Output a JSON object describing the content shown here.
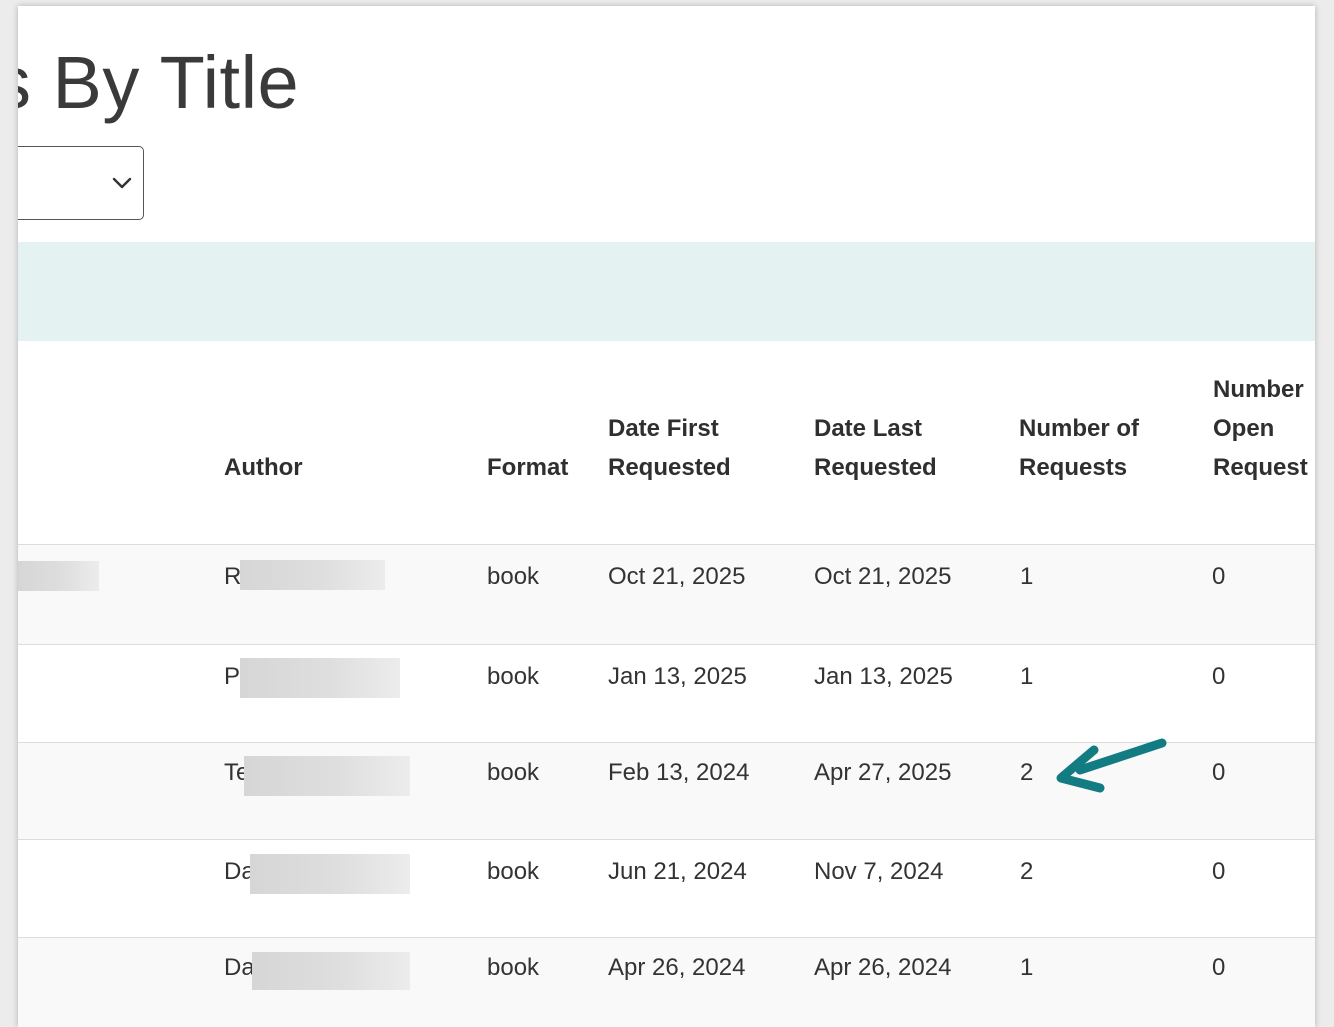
{
  "page": {
    "title": "s By Title"
  },
  "filter": {
    "selected": ""
  },
  "table": {
    "headers": {
      "author": "Author",
      "format": "Format",
      "first_line1": "Date First",
      "first_line2": "Requested",
      "last_line1": "Date Last",
      "last_line2": "Requested",
      "num_line1": "Number of",
      "num_line2": "Requests",
      "open_line1": "Number",
      "open_line2": "Open",
      "open_line3": "Request"
    },
    "rows": [
      {
        "author": "R",
        "format": "book",
        "first": "Oct 21, 2025",
        "last": "Oct 21, 2025",
        "requests": "1",
        "open": "0"
      },
      {
        "author": "P",
        "format": "book",
        "first": "Jan 13, 2025",
        "last": "Jan 13, 2025",
        "requests": "1",
        "open": "0"
      },
      {
        "author": "Te",
        "format": "book",
        "first": "Feb 13, 2024",
        "last": "Apr 27, 2025",
        "requests": "2",
        "open": "0"
      },
      {
        "author": "Da",
        "format": "book",
        "first": "Jun 21, 2024",
        "last": "Nov 7, 2024",
        "requests": "2",
        "open": "0"
      },
      {
        "author": "Da",
        "format": "book",
        "first": "Apr 26, 2024",
        "last": "Apr 26, 2024",
        "requests": "1",
        "open": "0"
      }
    ]
  },
  "colors": {
    "banner": "#e4f2f2",
    "arrow": "#127c82"
  },
  "icons": {
    "select": "chevron-down-icon",
    "annotation": "arrow-icon"
  }
}
